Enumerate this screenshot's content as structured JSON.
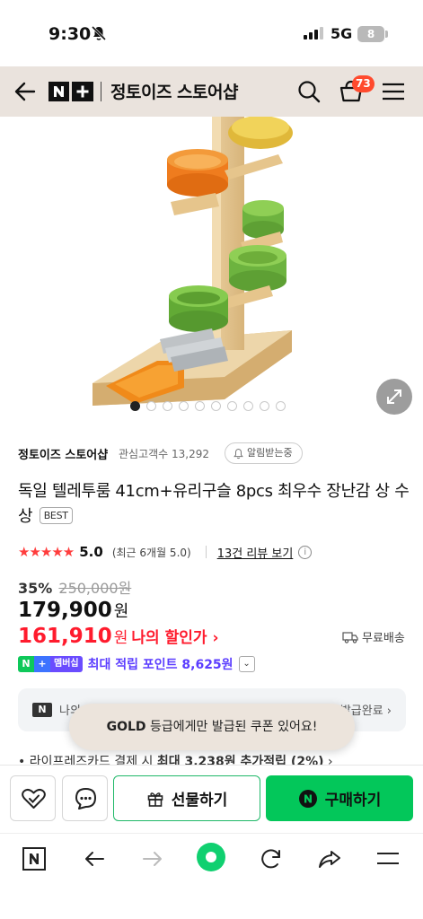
{
  "status_bar": {
    "time": "9:30",
    "network": "5G",
    "battery": "8"
  },
  "header": {
    "store_name": "정토이즈 스토어샵",
    "cart_count": "73"
  },
  "gallery": {
    "total_images": 10,
    "active_index": 0
  },
  "store": {
    "name": "정토이즈 스토어샵",
    "fans": "관심고객수 13,292",
    "alert_label": "알림받는중"
  },
  "product": {
    "title": "독일 텔레투룸 41cm+유리구슬 8pcs 최우수 장난감 상 수상",
    "best_badge": "BEST"
  },
  "rating": {
    "stars": "★★★★★",
    "score": "5.0",
    "recent": "(최근 6개월 5.0)",
    "reviews": "13건 리뷰 보기",
    "info": "i"
  },
  "price": {
    "discount_pct": "35%",
    "original": "250,000원",
    "sale": "179,900",
    "unit": "원",
    "my_price": "161,910",
    "my_price_label": "나의 할인가 ›",
    "shipping": "무료배송"
  },
  "membership": {
    "badge_n": "N",
    "badge_plus": "+",
    "badge_label": "멤버십",
    "points": "최대 적립 포인트 8,625원"
  },
  "coupon": {
    "badge": "N",
    "text": "나의 첫 스토어 쿠폰 받기",
    "right": "발급완료 ›"
  },
  "toast": {
    "strong": "GOLD",
    "text": " 등급에게만 발급된 쿠폰 있어요!"
  },
  "card_benefit": {
    "prefix": "• 라이프레즈카드 결제 시 ",
    "strong": "최대 3,238원 추가적립 (2%)",
    "suffix": " ›"
  },
  "actions": {
    "gift": "선물하기",
    "buy": "구매하기",
    "buy_logo": "N"
  },
  "colors": {
    "header_bg": "#eae3dd",
    "naver_green": "#03c75a",
    "sale_red": "#ff1b2d",
    "membership_purple": "#5b3dff",
    "star_red": "#ff3d3d",
    "cart_badge": "#ff4a2d"
  }
}
